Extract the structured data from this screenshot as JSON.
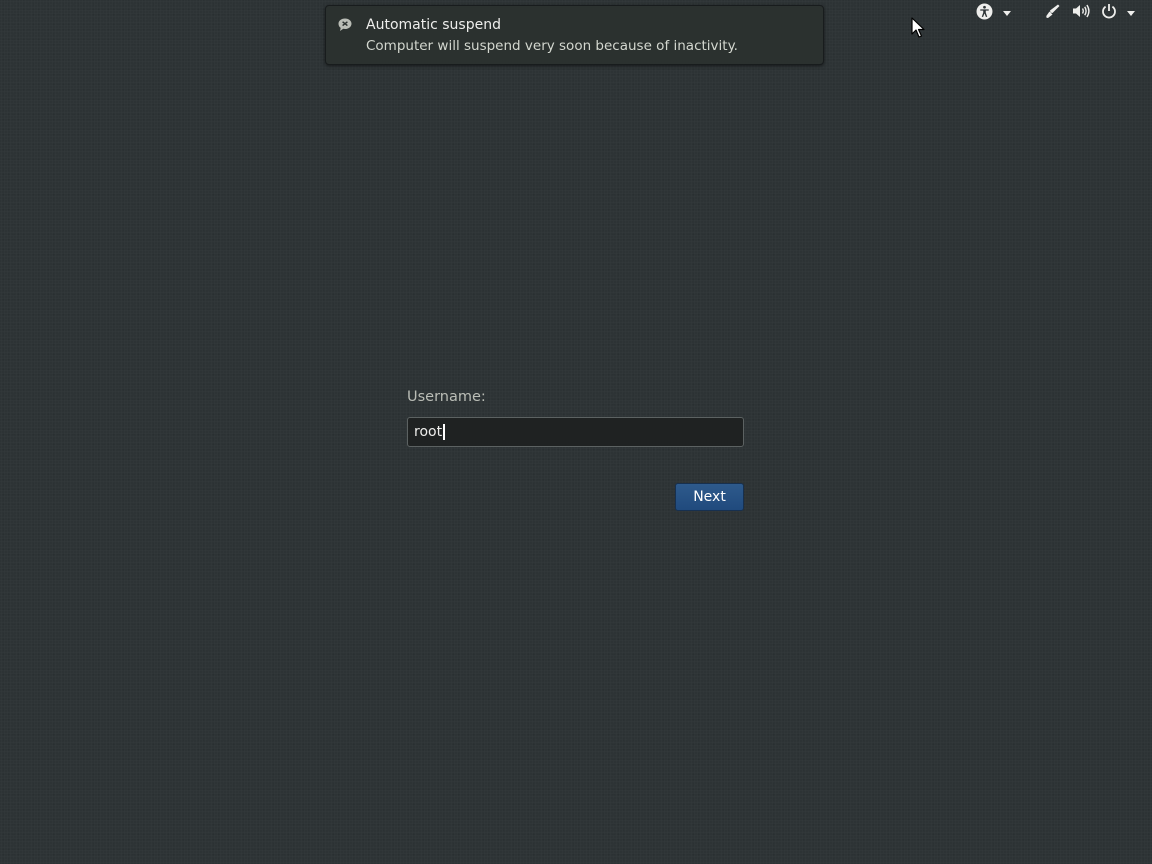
{
  "notification": {
    "icon": "chat-bubble-icon",
    "title": "Automatic suspend",
    "body": "Computer will suspend very soon because of inactivity."
  },
  "top_bar": {
    "indicators": [
      {
        "name": "accessibility-menu",
        "icon": "accessibility-icon",
        "has_dropdown": true
      },
      {
        "name": "input-method",
        "icon": "pen-icon"
      },
      {
        "name": "volume",
        "icon": "speaker-icon"
      },
      {
        "name": "power-menu",
        "icon": "power-icon",
        "has_dropdown": true
      }
    ]
  },
  "login": {
    "username_label": "Username:",
    "username_value": "root",
    "next_label": "Next"
  },
  "colors": {
    "background": "#2d3335",
    "button": "#275083",
    "text": "#eeeeec"
  }
}
